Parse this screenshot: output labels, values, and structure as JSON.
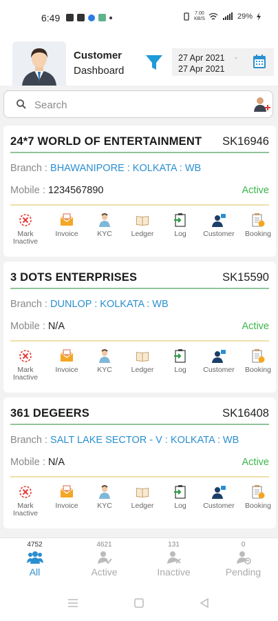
{
  "status_bar": {
    "time": "6:49",
    "speed_top": "7.00",
    "speed_bottom": "KB/S",
    "battery": "29%"
  },
  "header": {
    "title_line1": "Customer",
    "title_line2": "Dashboard",
    "date_from": "27 Apr 2021",
    "date_separator": "-",
    "date_to": "27 Apr 2021"
  },
  "search": {
    "placeholder": "Search"
  },
  "labels": {
    "branch": "Branch : ",
    "mobile": "Mobile : "
  },
  "customers": [
    {
      "name": "24*7 WORLD OF ENTERTAINMENT",
      "code": "SK16946",
      "branch": "BHAWANIPORE : KOLKATA : WB",
      "mobile": "1234567890",
      "status": "Active"
    },
    {
      "name": "3 DOTS ENTERPRISES",
      "code": "SK15590",
      "branch": "DUNLOP : KOLKATA : WB",
      "mobile": "N/A",
      "status": "Active"
    },
    {
      "name": "361 DEGEERS",
      "code": "SK16408",
      "branch": "SALT LAKE SECTOR - V : KOLKATA : WB",
      "mobile": "N/A",
      "status": "Active"
    }
  ],
  "actions": [
    {
      "label": "Mark Inactive",
      "icon": "mark-inactive-icon"
    },
    {
      "label": "Invoice",
      "icon": "invoice-icon"
    },
    {
      "label": "KYC",
      "icon": "kyc-icon"
    },
    {
      "label": "Ledger",
      "icon": "ledger-icon"
    },
    {
      "label": "Log",
      "icon": "log-icon"
    },
    {
      "label": "Customer",
      "icon": "customer-icon"
    },
    {
      "label": "Booking",
      "icon": "booking-icon"
    }
  ],
  "tabs": [
    {
      "count": "4752",
      "label": "All",
      "icon": "all-users-icon",
      "active": true
    },
    {
      "count": "4621",
      "label": "Active",
      "icon": "active-user-icon",
      "active": false
    },
    {
      "count": "131",
      "label": "Inactive",
      "icon": "inactive-user-icon",
      "active": false
    },
    {
      "count": "0",
      "label": "Pending",
      "icon": "pending-user-icon",
      "active": false
    }
  ],
  "colors": {
    "accent": "#2a8fd0",
    "active_status": "#3ab54a",
    "inactive_red": "#e53935"
  }
}
